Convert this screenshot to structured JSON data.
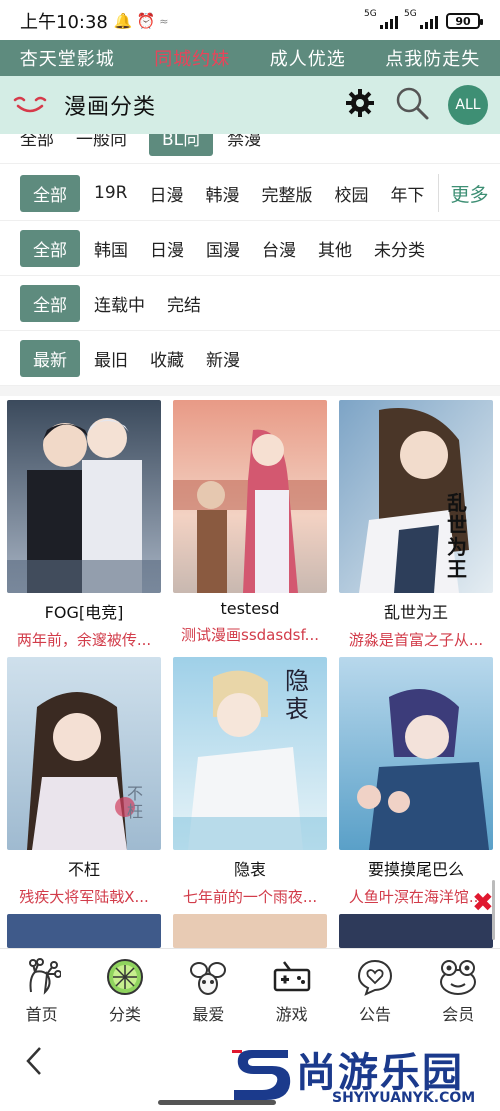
{
  "status_bar": {
    "time": "上午10:38",
    "signal1": "5G",
    "signal2": "5G",
    "battery": "90"
  },
  "promo": {
    "items": [
      "杏天堂影城",
      "同城约妹",
      "成人优选",
      "点我防走失"
    ]
  },
  "header": {
    "title": "漫画分类",
    "all_label": "ALL"
  },
  "filters": {
    "row1": [
      "全部",
      "一般向",
      "BL向",
      "禁漫"
    ],
    "row2": [
      "全部",
      "19R",
      "日漫",
      "韩漫",
      "完整版",
      "校园",
      "年下"
    ],
    "row2_more": "更多",
    "row3": [
      "全部",
      "韩国",
      "日漫",
      "国漫",
      "台漫",
      "其他",
      "未分类"
    ],
    "row4": [
      "全部",
      "连载中",
      "完结"
    ],
    "row5": [
      "最新",
      "最旧",
      "收藏",
      "新漫"
    ]
  },
  "comics": [
    {
      "title": "FOG[电竞]",
      "desc": "两年前，余邃被传..."
    },
    {
      "title": "testesd",
      "desc": "测试漫画ssdasdsf..."
    },
    {
      "title": "乱世为王",
      "desc": "游淼是首富之子从..."
    },
    {
      "title": "不枉",
      "desc": "残疾大将军陆戟X..."
    },
    {
      "title": "隐衷",
      "desc": "七年前的一个雨夜..."
    },
    {
      "title": "要摸摸尾巴么",
      "desc": "人鱼叶溟在海洋馆..."
    }
  ],
  "cover_texts": {
    "c3": "乱世为王",
    "c4": "不枉",
    "c5": "隐衷"
  },
  "tabs": [
    "首页",
    "分类",
    "最爱",
    "游戏",
    "公告",
    "会员"
  ],
  "watermark": {
    "big": "尚游乐园",
    "small": "SHYIYUANYK.COM"
  },
  "colors": {
    "accent": "#5e8b7e",
    "header_bg": "#d4ede5",
    "desc_red": "#d23c4a",
    "promo_hot": "#e8445a"
  }
}
